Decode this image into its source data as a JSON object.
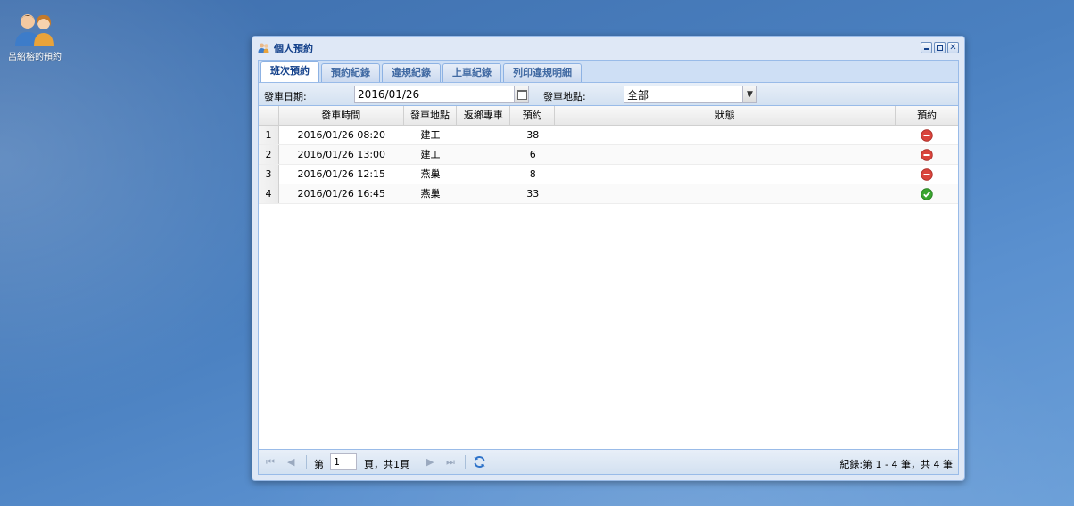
{
  "desktop": {
    "icon_label": "呂紹榕的預約"
  },
  "window": {
    "title": "個人預約"
  },
  "tabs": [
    "班次預約",
    "預約紀錄",
    "違規紀錄",
    "上車紀錄",
    "列印違規明細"
  ],
  "toolbar": {
    "date_label": "發車日期:",
    "date_value": "2016/01/26",
    "location_label": "發車地點:",
    "location_value": "全部"
  },
  "grid": {
    "columns": [
      "發車時間",
      "發車地點",
      "返鄉專車",
      "預約",
      "狀態",
      "預約"
    ],
    "rows": [
      {
        "num": "1",
        "time": "2016/01/26 08:20",
        "location": "建工",
        "homecoming": "",
        "count": "38",
        "status": "",
        "action_icon": "remove-icon",
        "action_color": "#d9443c"
      },
      {
        "num": "2",
        "time": "2016/01/26 13:00",
        "location": "建工",
        "homecoming": "",
        "count": "6",
        "status": "",
        "action_icon": "remove-icon",
        "action_color": "#d9443c"
      },
      {
        "num": "3",
        "time": "2016/01/26 12:15",
        "location": "燕巢",
        "homecoming": "",
        "count": "8",
        "status": "",
        "action_icon": "remove-icon",
        "action_color": "#d9443c"
      },
      {
        "num": "4",
        "time": "2016/01/26 16:45",
        "location": "燕巢",
        "homecoming": "",
        "count": "33",
        "status": "",
        "action_icon": "check-icon",
        "action_color": "#3aa52f"
      }
    ]
  },
  "paging": {
    "page_label": "第",
    "page_value": "1",
    "page_of": "頁，共1頁",
    "info": "紀錄:第 1 - 4 筆，共 4 筆"
  }
}
